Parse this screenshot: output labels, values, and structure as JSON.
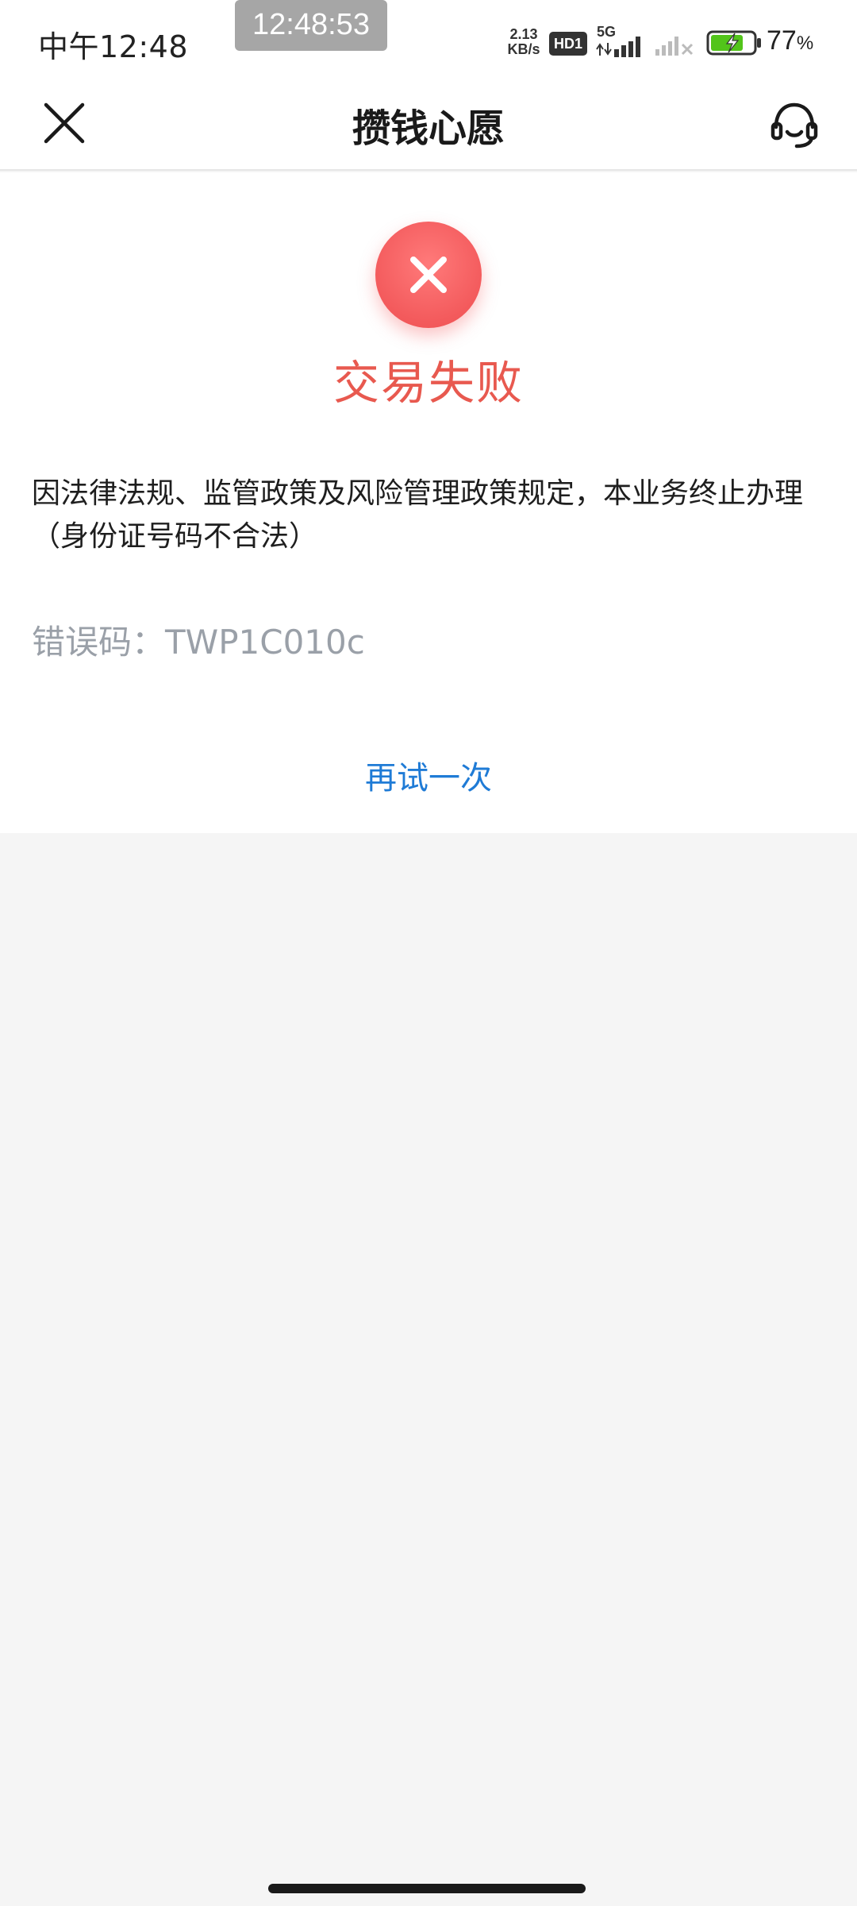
{
  "status_bar": {
    "time": "中午12:48",
    "clock_overlay": "12:48:53",
    "net_speed_value": "2.13",
    "net_speed_unit": "KB/s",
    "hd_badge": "HD1",
    "network_type": "5G",
    "battery_percent": "77",
    "battery_percent_sign": "%",
    "battery_level": 0.77,
    "battery_charging": true,
    "battery_color": "#52c41a"
  },
  "nav": {
    "title": "攒钱心愿",
    "close_icon": "close-icon",
    "support_icon": "headset-icon"
  },
  "result": {
    "status_icon": "error-x-icon",
    "status_color": "#f35a5c",
    "title": "交易失败",
    "message": "因法律法规、监管政策及风险管理政策规定，本业务终止办理（身份证号码不合法）",
    "error_code_label": "错误码：",
    "error_code": "TWP1C010c",
    "retry_label": "再试一次",
    "link_color": "#1f7bd6"
  }
}
